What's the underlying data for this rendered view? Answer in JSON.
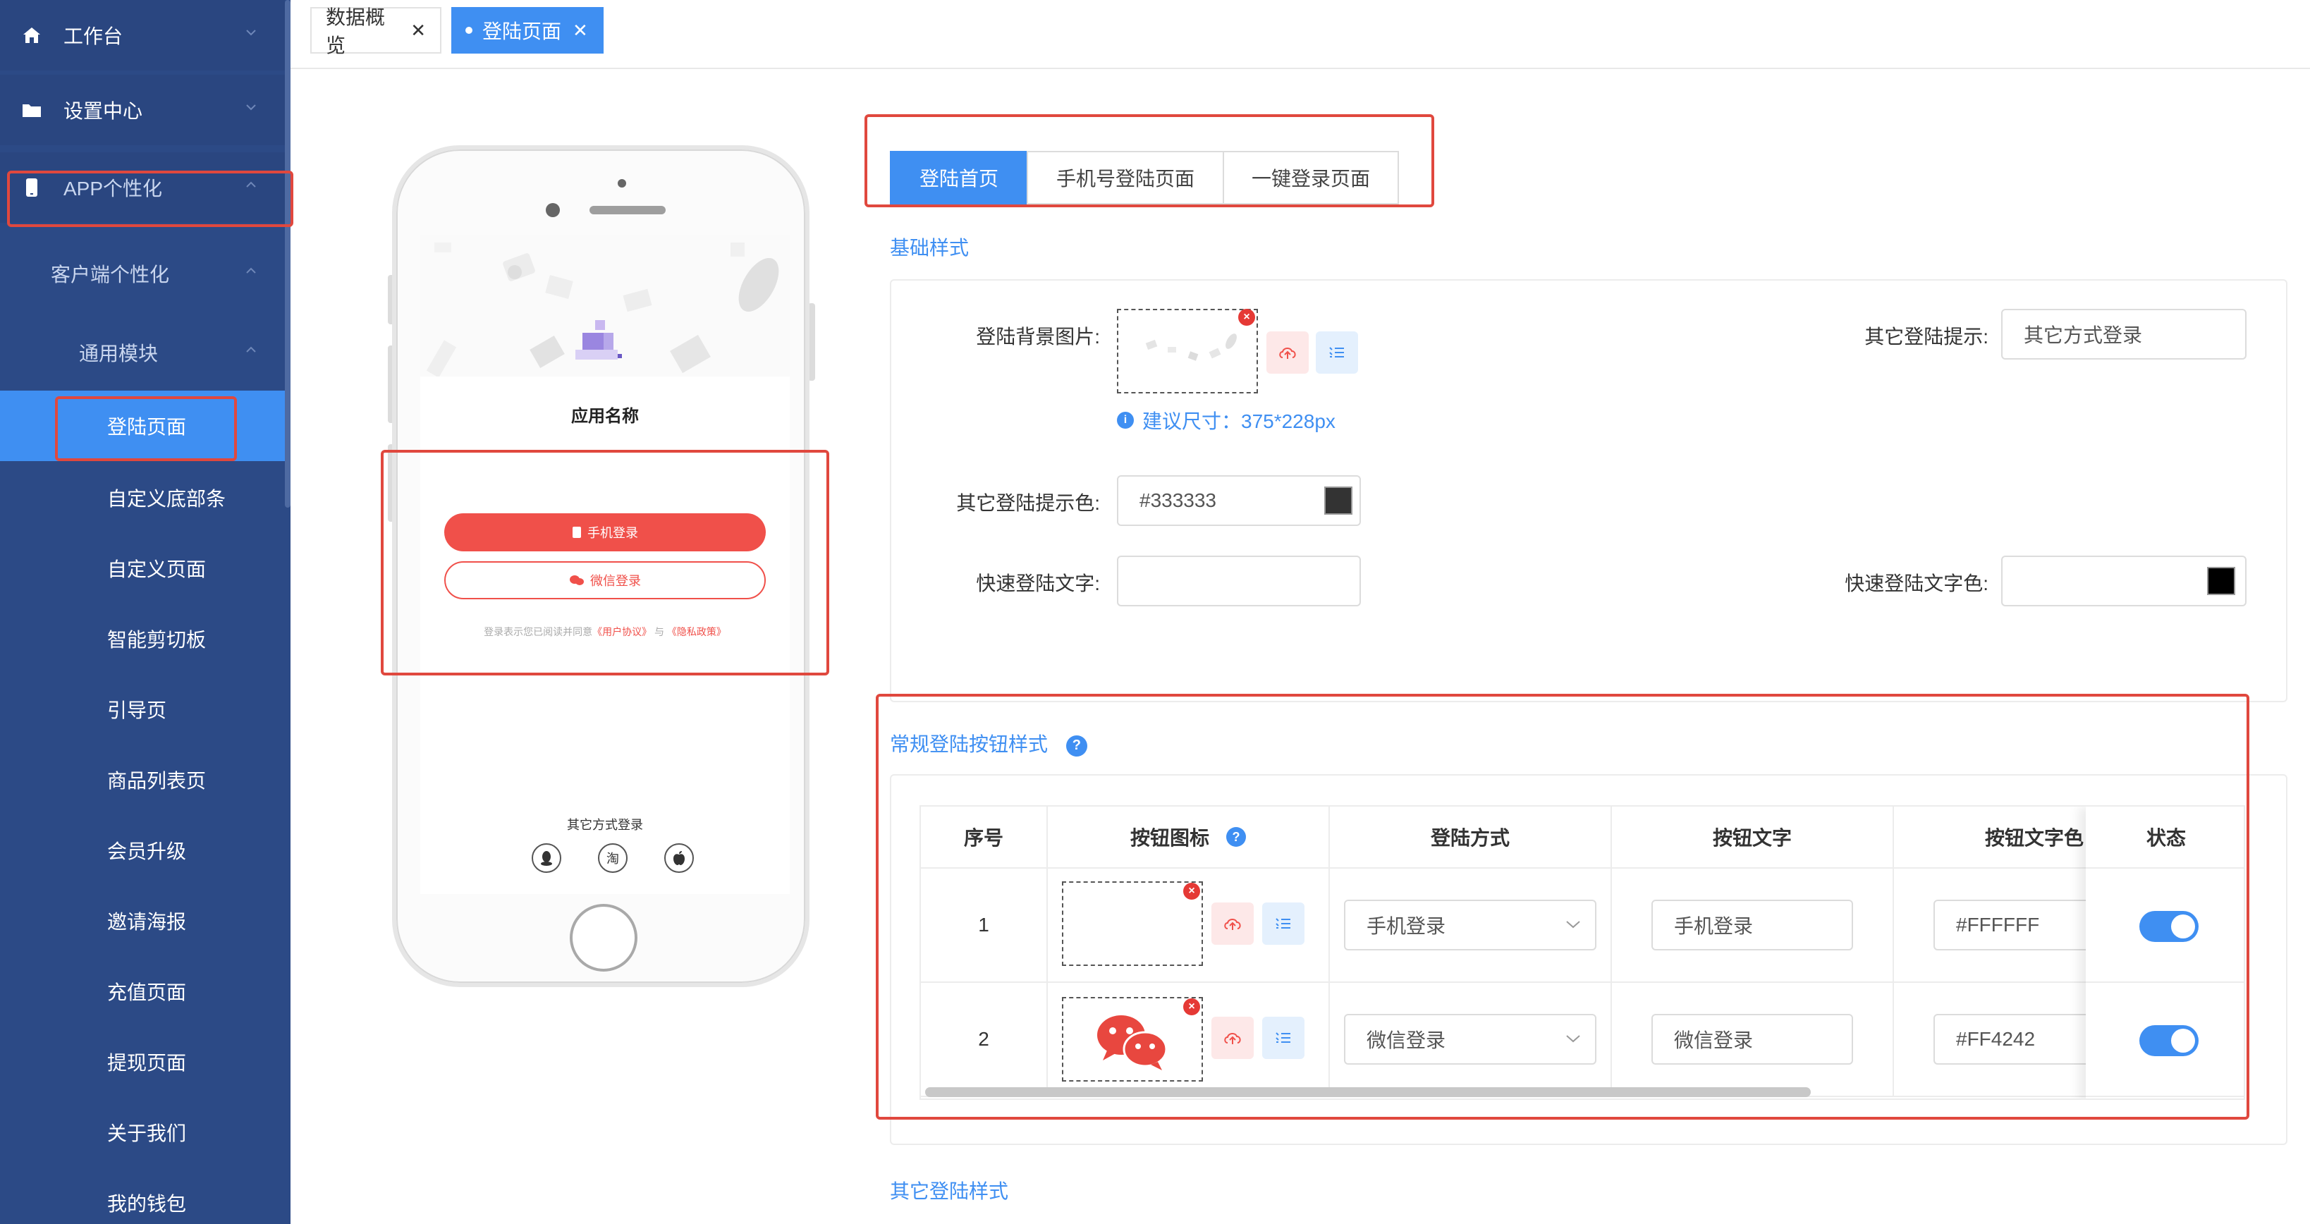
{
  "sidebar": {
    "items": [
      {
        "label": "工作台",
        "icon": "home-icon"
      },
      {
        "label": "设置中心",
        "icon": "folder-icon"
      },
      {
        "label": "APP个性化",
        "icon": "phone-icon"
      },
      {
        "label": "客户端个性化"
      },
      {
        "label": "通用模块"
      },
      {
        "label": "登陆页面"
      },
      {
        "label": "自定义底部条"
      },
      {
        "label": "自定义页面"
      },
      {
        "label": "智能剪切板"
      },
      {
        "label": "引导页"
      },
      {
        "label": "商品列表页"
      },
      {
        "label": "会员升级"
      },
      {
        "label": "邀请海报"
      },
      {
        "label": "充值页面"
      },
      {
        "label": "提现页面"
      },
      {
        "label": "关于我们"
      },
      {
        "label": "我的钱包"
      }
    ]
  },
  "tabs": [
    {
      "label": "数据概览",
      "close": "✕"
    },
    {
      "label": "登陆页面",
      "close": "✕"
    }
  ],
  "phone": {
    "app_name": "应用名称",
    "phone_login": "手机登录",
    "wechat_login": "微信登录",
    "agree_prefix": "登录表示您已阅读并同意",
    "agree_user": "《用户协议》",
    "agree_mid": "与",
    "agree_privacy": "《隐私政策》",
    "other_title": "其它方式登录",
    "taobao_char": "淘"
  },
  "segments": [
    "登陆首页",
    "手机号登陆页面",
    "一键登录页面"
  ],
  "basic": {
    "title": "基础样式",
    "bg_label": "登陆背景图片:",
    "hint": "建议尺寸：375*228px",
    "other_tip_label": "其它登陆提示:",
    "other_tip_value": "其它方式登录",
    "other_tip_color_label": "其它登陆提示色:",
    "other_tip_color_value": "#333333",
    "other_tip_color_hex": "#333333",
    "quick_text_label": "快速登陆文字:",
    "quick_text_value": "",
    "quick_color_label": "快速登陆文字色:",
    "quick_color_value": "",
    "quick_color_hex": "#000000"
  },
  "buttons_section": {
    "title": "常规登陆按钮样式",
    "headers": [
      "序号",
      "按钮图标",
      "登陆方式",
      "按钮文字",
      "按钮文字色",
      "状态"
    ],
    "rows": [
      {
        "index": "1",
        "method": "手机登录",
        "text": "手机登录",
        "color": "#FFFFFF",
        "enabled": true
      },
      {
        "index": "2",
        "method": "微信登录",
        "text": "微信登录",
        "color": "#FF4242",
        "enabled": true
      }
    ]
  },
  "other_section": {
    "title": "其它登陆样式"
  },
  "colors": {
    "accent": "#3f8ff2",
    "sidebar": "#2c4a86",
    "brand_red": "#f0504a"
  }
}
